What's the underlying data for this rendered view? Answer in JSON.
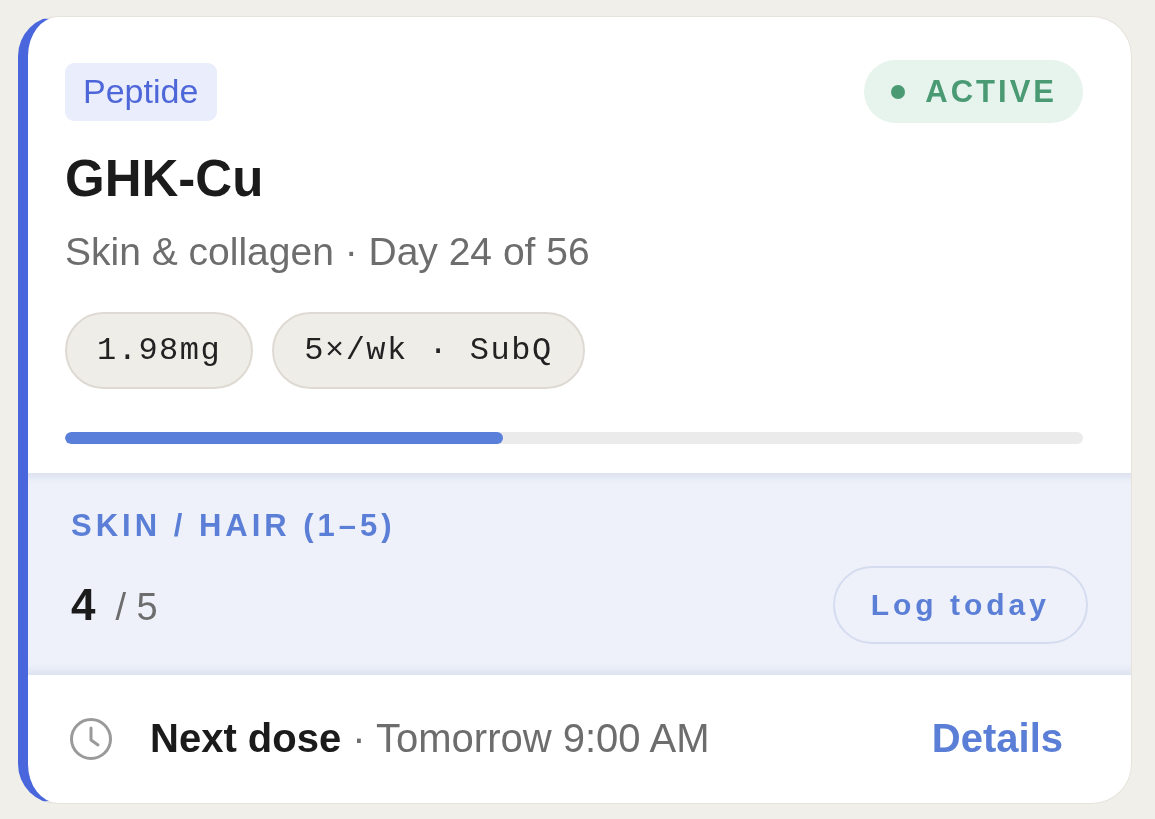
{
  "card": {
    "category": "Peptide",
    "status": "ACTIVE",
    "name": "GHK-Cu",
    "summary": "Skin & collagen · Day 24 of 56",
    "chips": [
      "1.98mg",
      "5×/wk · SubQ"
    ],
    "progress": {
      "level": 0.43
    }
  },
  "metric": {
    "label": "SKIN / HAIR (1–5)",
    "value": "4",
    "scale": "/ 5",
    "button": "Log today"
  },
  "footer": {
    "next_dose": "**Next dose** · Tomorrow 9:00 AM",
    "link": "Details"
  }
}
